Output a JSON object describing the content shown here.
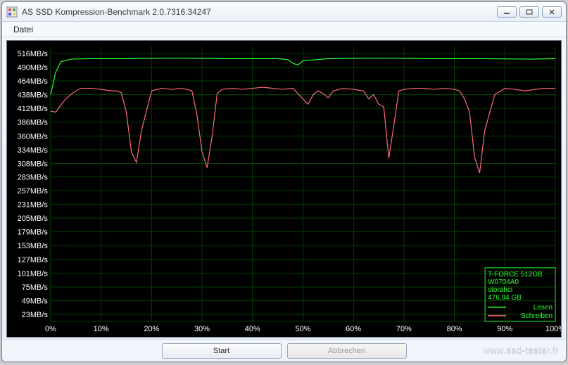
{
  "window": {
    "title": "AS SSD Kompression-Benchmark 2.0.7316.34247"
  },
  "menubar": {
    "file": "Datei"
  },
  "buttons": {
    "start": "Start",
    "cancel": "Abbrechen"
  },
  "watermark": "www.ssd-tester.fr",
  "legend": {
    "device": "T-FORCE 512GB",
    "firmware": "W0704A0",
    "driver": "storahci",
    "capacity": "476,94 GB",
    "read_label": "Lesen",
    "write_label": "Schreiben"
  },
  "chart_data": {
    "type": "line",
    "xlabel": "",
    "ylabel": "",
    "x_unit": "%",
    "y_unit": "MB/s",
    "xlim": [
      0,
      100
    ],
    "ylim": [
      10,
      529
    ],
    "y_ticks": [
      23,
      49,
      75,
      101,
      127,
      153,
      179,
      205,
      231,
      257,
      283,
      308,
      334,
      360,
      386,
      412,
      438,
      464,
      490,
      516
    ],
    "y_tick_labels": [
      "23MB/s",
      "49MB/s",
      "75MB/s",
      "101MB/s",
      "127MB/s",
      "153MB/s",
      "179MB/s",
      "205MB/s",
      "231MB/s",
      "257MB/s",
      "283MB/s",
      "308MB/s",
      "334MB/s",
      "360MB/s",
      "386MB/s",
      "412MB/s",
      "438MB/s",
      "464MB/s",
      "490MB/s",
      "516MB/s"
    ],
    "x_ticks": [
      0,
      10,
      20,
      30,
      40,
      50,
      60,
      70,
      80,
      90,
      100
    ],
    "x_tick_labels": [
      "0%",
      "10%",
      "20%",
      "30%",
      "40%",
      "50%",
      "60%",
      "70%",
      "80%",
      "90%",
      "100%"
    ],
    "series": [
      {
        "name": "Lesen",
        "color": "#2dff2d",
        "x": [
          0,
          1,
          2,
          4,
          8,
          15,
          25,
          35,
          45,
          47,
          48,
          49,
          50,
          55,
          65,
          75,
          85,
          95,
          100
        ],
        "y": [
          438,
          480,
          500,
          505,
          506,
          506,
          507,
          506,
          506,
          504,
          497,
          494,
          502,
          506,
          507,
          506,
          506,
          505,
          506
        ]
      },
      {
        "name": "Schreiben",
        "color": "#ff6a7a",
        "x": [
          0,
          1,
          2,
          3,
          4,
          5,
          6,
          8,
          10,
          12,
          13,
          14,
          15,
          16,
          17,
          18,
          20,
          22,
          24,
          26,
          27,
          28,
          29,
          30,
          31,
          32,
          33,
          34,
          36,
          38,
          40,
          42,
          44,
          46,
          48,
          50,
          51,
          52,
          53,
          54,
          55,
          56,
          58,
          60,
          62,
          63,
          64,
          65,
          66,
          67,
          68,
          69,
          70,
          72,
          74,
          76,
          78,
          80,
          81,
          82,
          83,
          84,
          85,
          86,
          88,
          90,
          92,
          94,
          96,
          98,
          100
        ],
        "y": [
          407,
          405,
          418,
          430,
          438,
          445,
          450,
          450,
          448,
          445,
          445,
          442,
          405,
          330,
          310,
          370,
          445,
          450,
          448,
          450,
          448,
          445,
          400,
          330,
          300,
          360,
          440,
          448,
          450,
          448,
          450,
          452,
          450,
          448,
          450,
          430,
          420,
          438,
          445,
          440,
          432,
          445,
          450,
          448,
          445,
          430,
          438,
          420,
          415,
          318,
          380,
          445,
          448,
          450,
          450,
          448,
          450,
          448,
          445,
          430,
          405,
          320,
          290,
          370,
          438,
          450,
          448,
          445,
          448,
          450,
          450
        ]
      }
    ]
  }
}
